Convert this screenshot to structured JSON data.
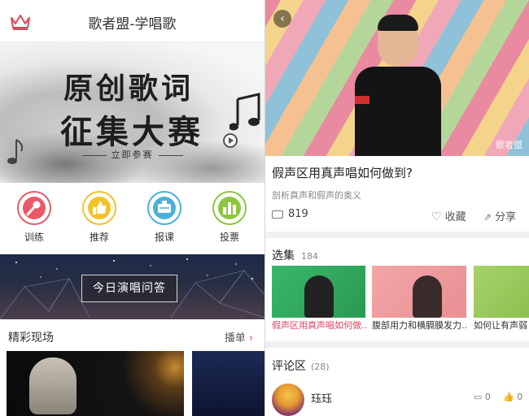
{
  "left": {
    "header": {
      "title": "歌者盟-学唱歌",
      "crown_icon": "crown-icon"
    },
    "banner": {
      "line1": "原创歌词",
      "line2": "征集大赛",
      "cta": "立即参赛",
      "icons": [
        "music-note-icon",
        "play-icon"
      ]
    },
    "quick_actions": [
      {
        "label": "训练",
        "icon": "microphone-icon",
        "color": "#e85a6a"
      },
      {
        "label": "推荐",
        "icon": "thumbs-up-icon",
        "color": "#f4c12b"
      },
      {
        "label": "报课",
        "icon": "course-icon",
        "color": "#4ab0d9"
      },
      {
        "label": "投票",
        "icon": "bar-chart-icon",
        "color": "#8cc63f"
      }
    ],
    "promo": {
      "label": "今日演唱问答"
    },
    "section": {
      "title": "精彩现场",
      "more": "播单",
      "more_icon": "chevron-right-icon"
    }
  },
  "right": {
    "video": {
      "title": "假声区用真声唱如何做到?",
      "subtitle": "剖析真声和假声的奥义",
      "views": "819",
      "collect": "收藏",
      "share": "分享",
      "watermark": "歌者盟"
    },
    "episodes": {
      "title": "选集",
      "count": "184",
      "items": [
        {
          "caption": "假声区用真声唱如何做..."
        },
        {
          "caption": "腹部用力和横膈膜发力..."
        },
        {
          "caption": "如何让有声弱"
        }
      ]
    },
    "comments": {
      "title": "评论区",
      "count": "(28)",
      "first": {
        "name": "珏珏",
        "reply_count": "0",
        "like_count": "0"
      }
    }
  }
}
